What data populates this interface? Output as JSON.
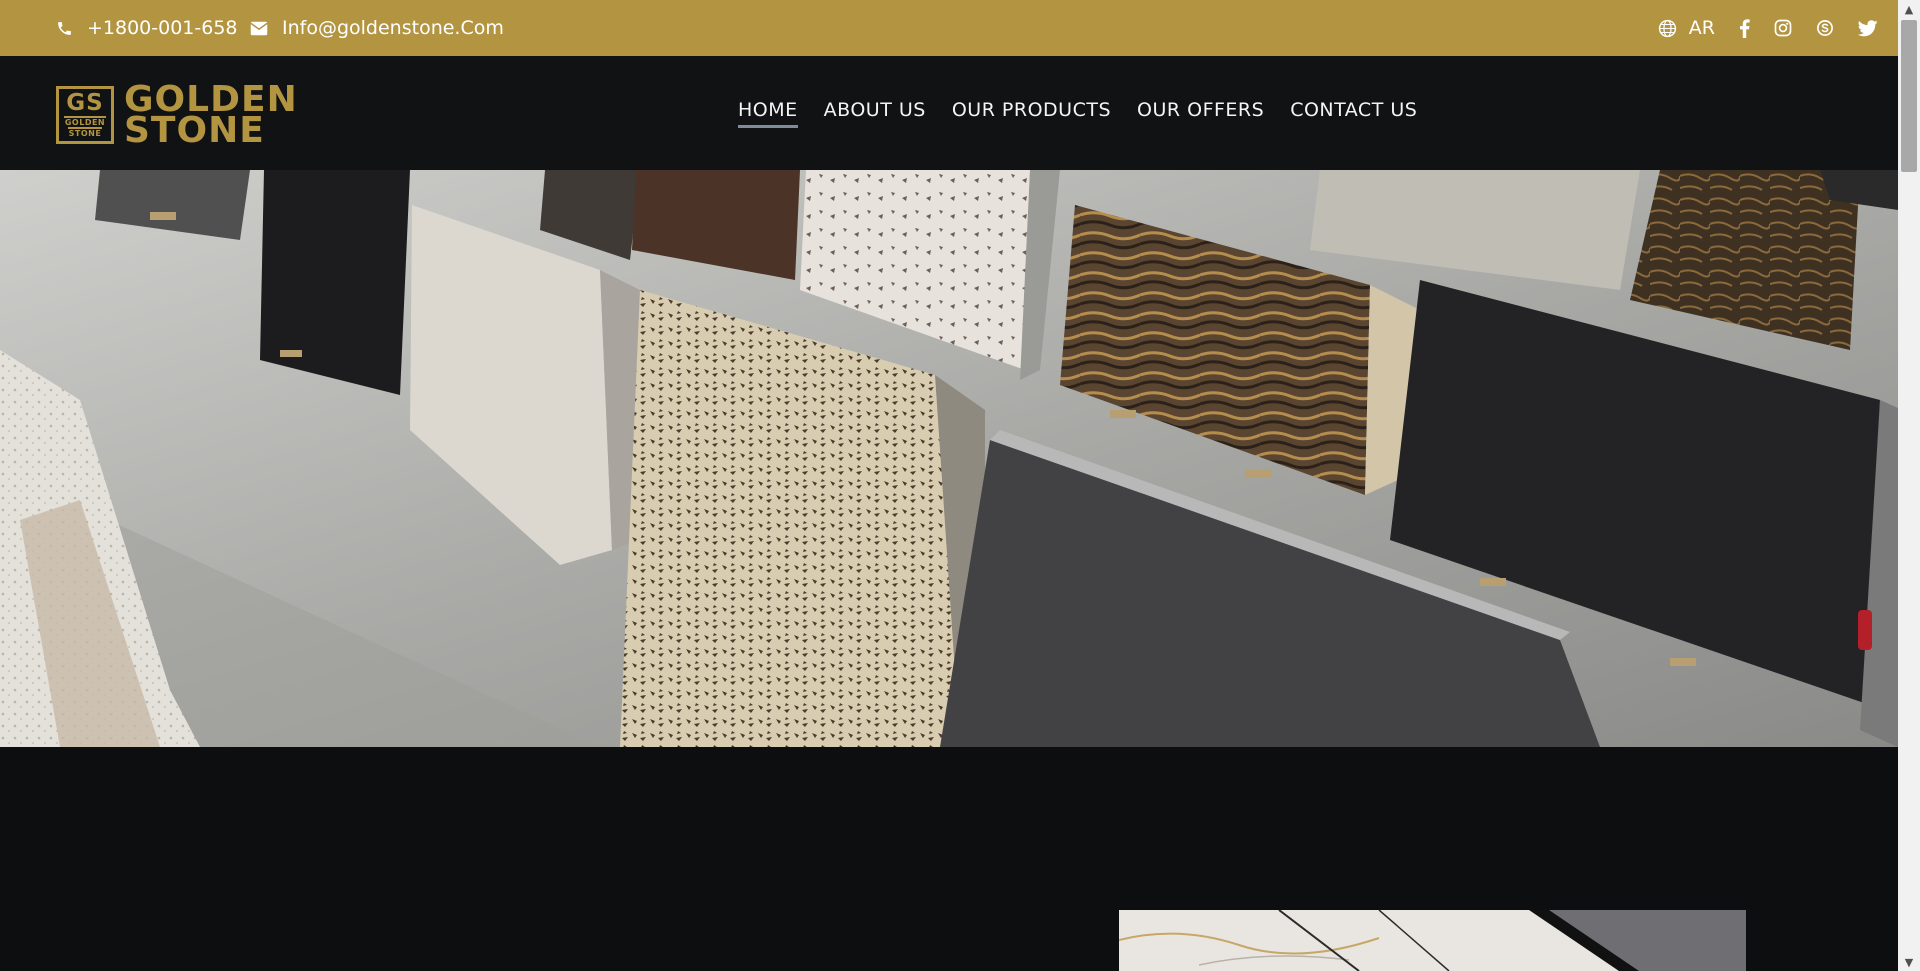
{
  "topbar": {
    "phone": "+1800-001-658",
    "email": "Info@goldenstone.Com",
    "language": "AR",
    "icons": [
      "phone-icon",
      "envelope-icon",
      "globe-icon",
      "facebook-icon",
      "instagram-icon",
      "skype-icon",
      "twitter-icon"
    ],
    "background_color": "#b39441"
  },
  "brand": {
    "logo_mark": "GS",
    "logo_mark_small_1": "GOLDEN",
    "logo_mark_small_2": "STONE",
    "name_line1": "GOLDEN",
    "name_line2": "STONE",
    "color": "#b39441"
  },
  "nav": {
    "items": [
      {
        "label": "HOME",
        "active": true
      },
      {
        "label": "ABOUT US",
        "active": false
      },
      {
        "label": "OUR PRODUCTS",
        "active": false
      },
      {
        "label": "OUR OFFERS",
        "active": false
      },
      {
        "label": "CONTACT US",
        "active": false
      }
    ]
  },
  "hero": {
    "image": "showroom-stone-slabs"
  },
  "lower_section": {
    "image": "marble-interior"
  }
}
